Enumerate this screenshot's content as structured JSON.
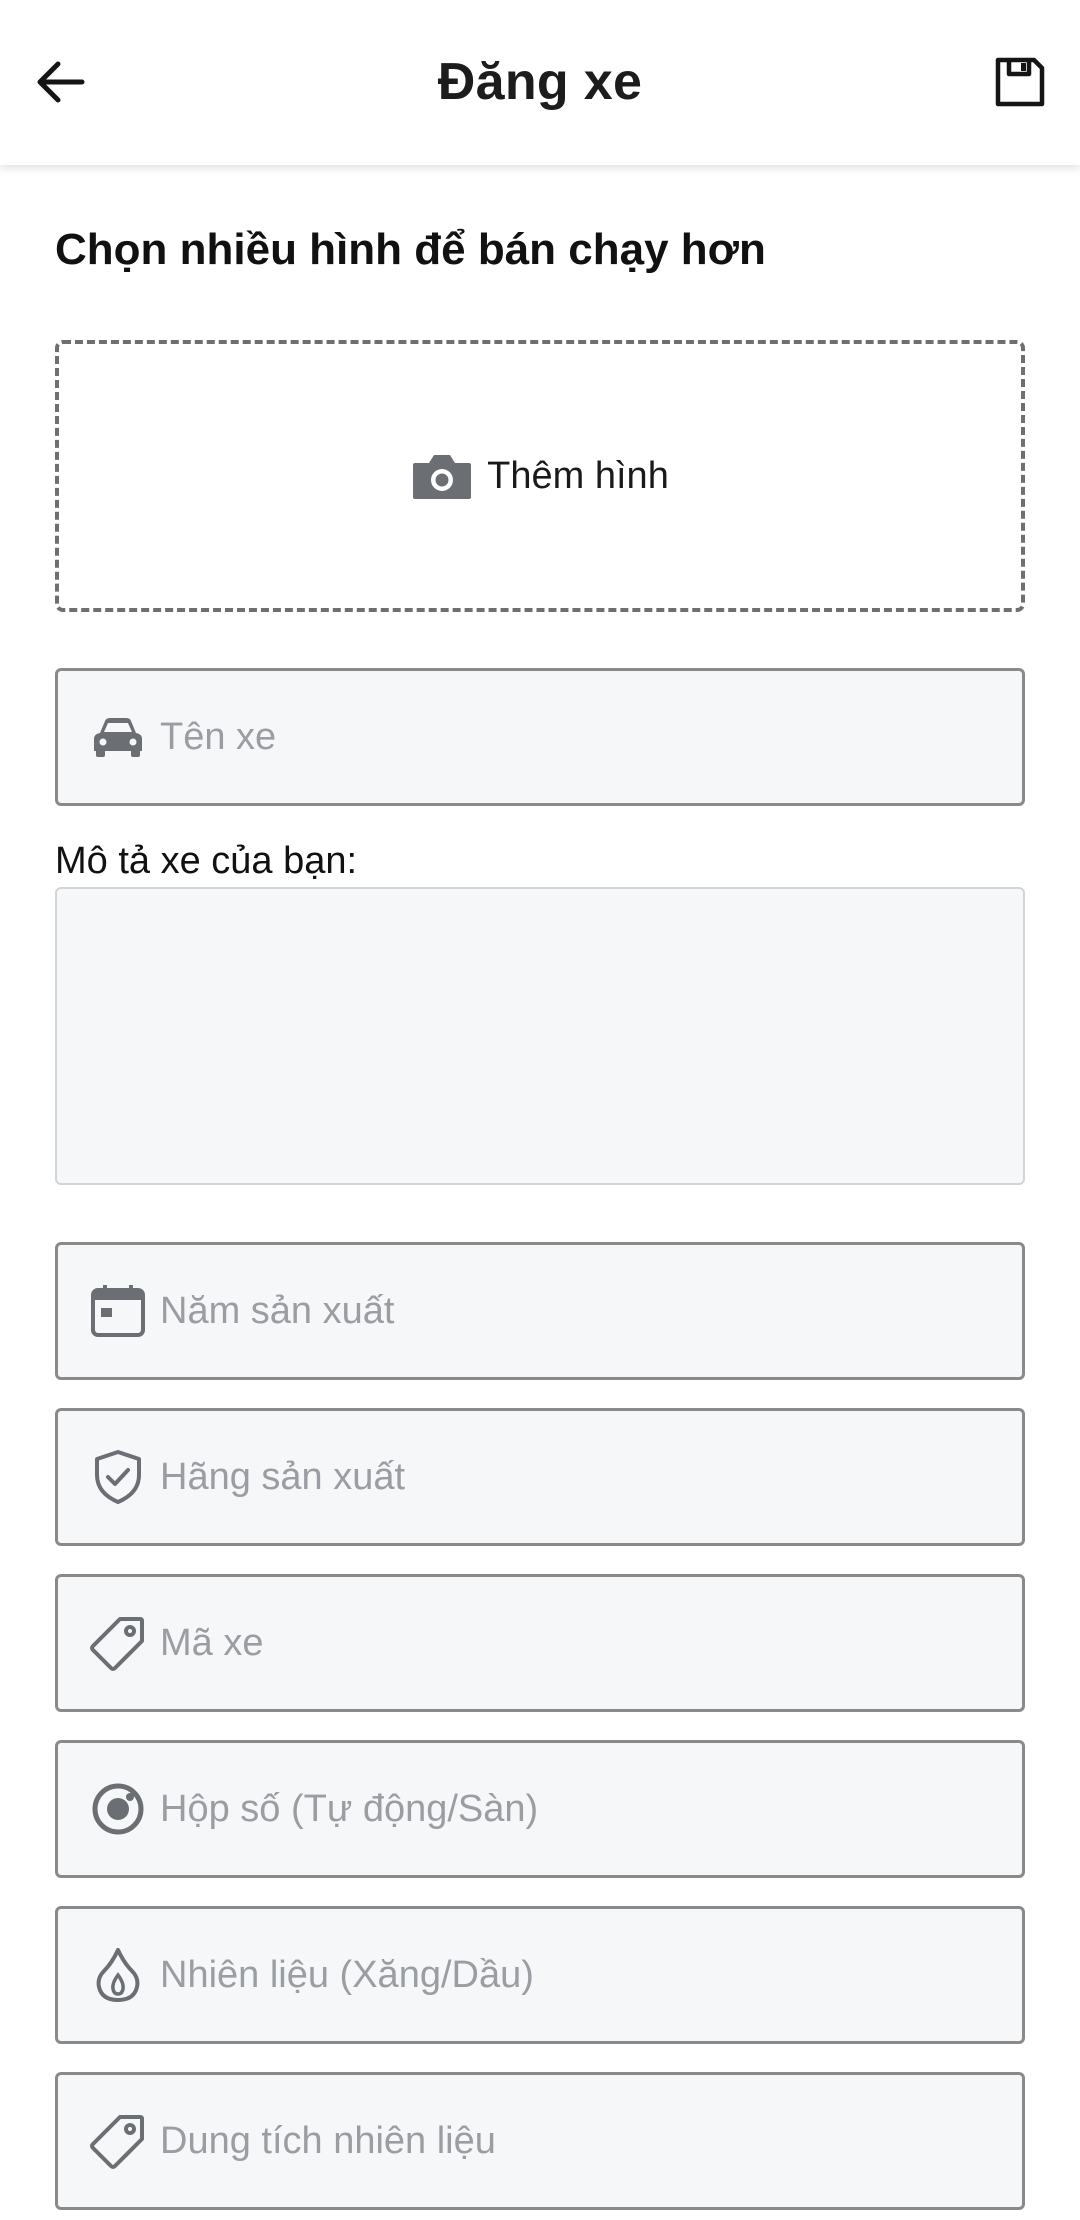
{
  "header": {
    "title": "Đăng xe",
    "back_icon": "arrow-left-icon",
    "save_icon": "floppy-disk-icon"
  },
  "photos": {
    "heading": "Chọn nhiều hình để bán chạy hơn",
    "add_label": "Thêm hình",
    "icon": "camera-icon"
  },
  "fields": {
    "car_name": {
      "placeholder": "Tên xe",
      "icon": "car-icon"
    },
    "description": {
      "label": "Mô tả xe của bạn:",
      "value": ""
    },
    "year": {
      "placeholder": "Năm sản xuất",
      "icon": "calendar-icon"
    },
    "brand": {
      "placeholder": "Hãng sản xuất",
      "icon": "shield-check-icon"
    },
    "model_code": {
      "placeholder": "Mã xe",
      "icon": "tag-icon"
    },
    "transmission": {
      "placeholder": "Hộp số (Tự động/Sàn)",
      "icon": "gear-circle-icon"
    },
    "fuel": {
      "placeholder": "Nhiên liệu (Xăng/Dầu)",
      "icon": "flame-icon"
    },
    "fuel_capacity": {
      "placeholder": "Dung tích nhiên liệu",
      "icon": "tag-icon"
    }
  },
  "colors": {
    "icon_gray": "#6b6f74",
    "placeholder_gray": "#9a9ea3",
    "field_background": "#f6f7f9"
  }
}
